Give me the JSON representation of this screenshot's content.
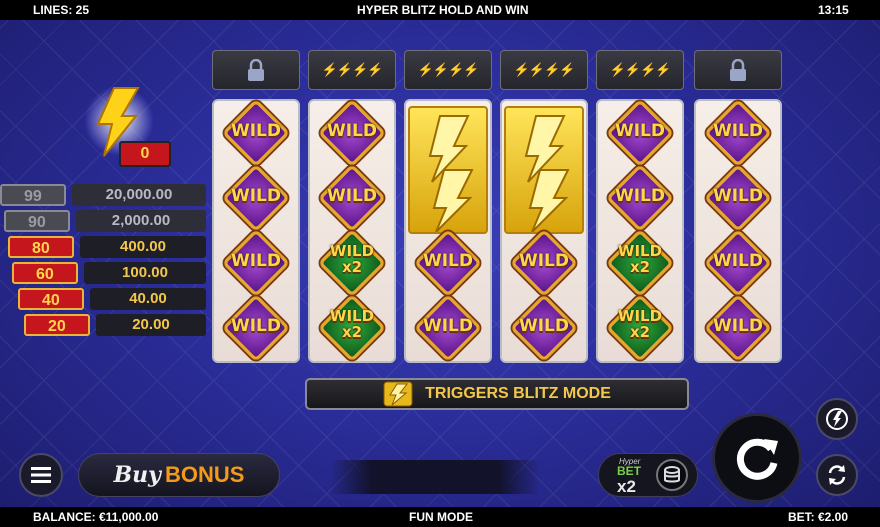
{
  "topbar": {
    "lines": "LINES: 25",
    "title": "HYPER BLITZ HOLD AND WIN",
    "time": "13:15"
  },
  "bottombar": {
    "balance": "BALANCE: €11,000.00",
    "mode": "FUN MODE",
    "bet": "BET: €2.00"
  },
  "blitz_counter": {
    "value": "0"
  },
  "paytable": [
    {
      "count": "99",
      "prize": "20,000.00",
      "active": false
    },
    {
      "count": "90",
      "prize": "2,000.00",
      "active": false
    },
    {
      "count": "80",
      "prize": "400.00",
      "active": true
    },
    {
      "count": "60",
      "prize": "100.00",
      "active": true
    },
    {
      "count": "40",
      "prize": "40.00",
      "active": true
    },
    {
      "count": "20",
      "prize": "20.00",
      "active": true
    }
  ],
  "reel_headers": [
    "lock-icon",
    "⚡⚡⚡⚡",
    "⚡⚡⚡⚡",
    "⚡⚡⚡⚡",
    "⚡⚡⚡⚡",
    "lock-icon"
  ],
  "reels": [
    [
      "WILD",
      "WILD",
      "WILD",
      "WILD"
    ],
    [
      "WILD",
      "WILD",
      "WILD x2",
      "WILD x2"
    ],
    [
      "BOLT",
      "BOLT",
      "WILD",
      "WILD"
    ],
    [
      "BOLT",
      "BOLT",
      "WILD",
      "WILD"
    ],
    [
      "WILD",
      "WILD",
      "WILD x2",
      "WILD x2"
    ],
    [
      "WILD",
      "WILD",
      "WILD",
      "WILD"
    ]
  ],
  "banner": {
    "label": "TRIGGERS BLITZ MODE"
  },
  "buy_bonus": {
    "buy": "Buy",
    "bonus": "BONUS"
  },
  "hyper_bet": {
    "top": "Hyper",
    "mid": "BET",
    "mult": "x2"
  },
  "colors": {
    "accent_gold": "#f3c74a",
    "badge_red": "#c4161c",
    "wild_purple": "#7b27b0",
    "wild_green": "#1f7a2a"
  }
}
